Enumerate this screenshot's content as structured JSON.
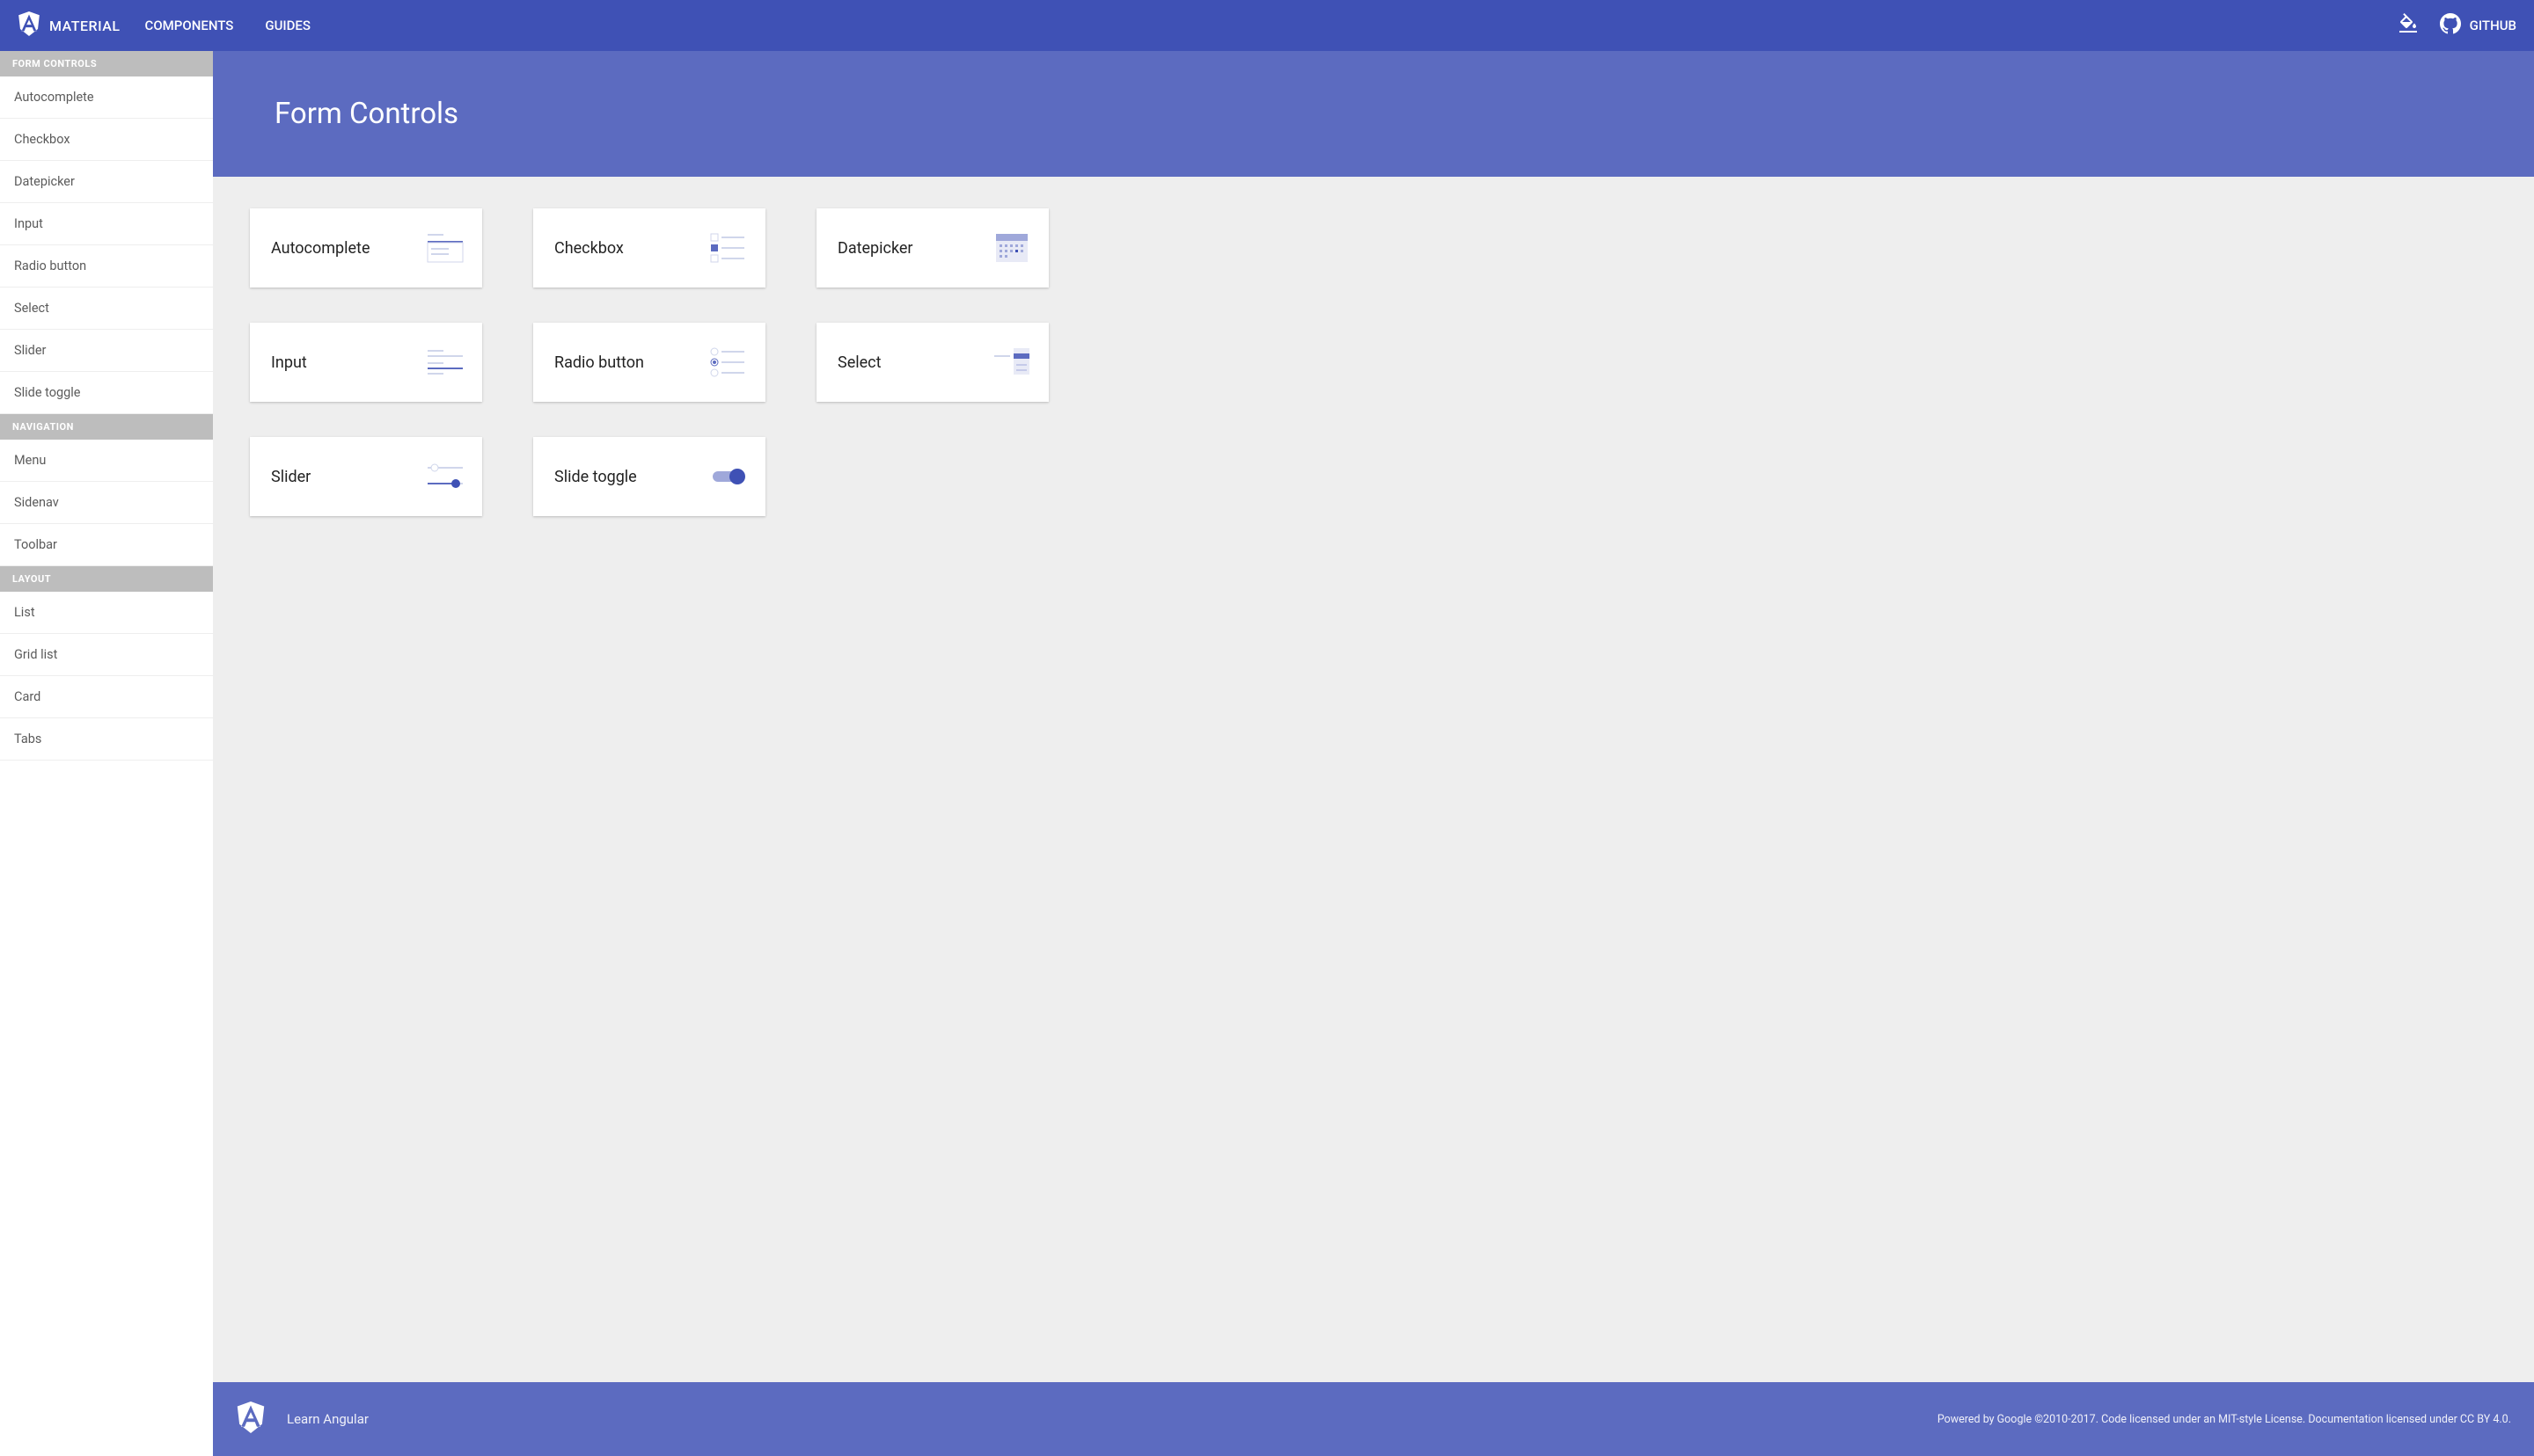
{
  "header": {
    "brand": "MATERIAL",
    "nav": [
      "COMPONENTS",
      "GUIDES"
    ],
    "github": "GITHUB"
  },
  "sidebar": {
    "sections": [
      {
        "title": "FORM CONTROLS",
        "items": [
          "Autocomplete",
          "Checkbox",
          "Datepicker",
          "Input",
          "Radio button",
          "Select",
          "Slider",
          "Slide toggle"
        ]
      },
      {
        "title": "NAVIGATION",
        "items": [
          "Menu",
          "Sidenav",
          "Toolbar"
        ]
      },
      {
        "title": "LAYOUT",
        "items": [
          "List",
          "Grid list",
          "Card",
          "Tabs"
        ]
      }
    ]
  },
  "page": {
    "title": "Form Controls",
    "cards": [
      {
        "label": "Autocomplete",
        "icon": "autocomplete-icon"
      },
      {
        "label": "Checkbox",
        "icon": "checkbox-icon"
      },
      {
        "label": "Datepicker",
        "icon": "datepicker-icon"
      },
      {
        "label": "Input",
        "icon": "input-icon"
      },
      {
        "label": "Radio button",
        "icon": "radio-icon"
      },
      {
        "label": "Select",
        "icon": "select-icon"
      },
      {
        "label": "Slider",
        "icon": "slider-icon"
      },
      {
        "label": "Slide toggle",
        "icon": "toggle-icon"
      }
    ]
  },
  "footer": {
    "learn": "Learn Angular",
    "legal": "Powered by Google ©2010-2017. Code licensed under an MIT-style License. Documentation licensed under CC BY 4.0."
  }
}
